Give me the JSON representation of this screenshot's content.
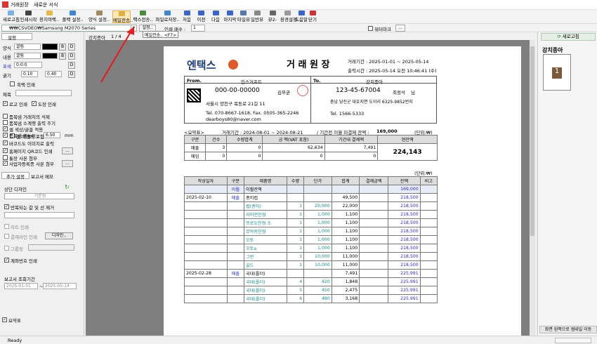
{
  "title": {
    "app": "거래원장",
    "subtitle": "새로운 서식"
  },
  "toolbar": [
    "새로고침",
    "인쇄시작",
    "용지여백..",
    "폴백 설정..",
    "양식 설정..",
    "메일전송..",
    "팩스전송..",
    "파일로저장..",
    "처음",
    "이전",
    "다음",
    "마지막",
    "타일뷰",
    "일반뷰",
    "뷰2-",
    "환경설정..",
    "도움말",
    "닫기"
  ],
  "toolbar2": {
    "path": "₩₩CSVDEO₩Samsung M2070 Series",
    "settings": "설정..",
    "copies_label": "인쇄 매수 :",
    "copies": "1",
    "watermark": "워터마크",
    "dots": "...",
    "tooltip": "메일전송.. <F7>"
  },
  "left": {
    "tab": "설정",
    "font1_label": "양식",
    "font1": "굴림",
    "font2_label": "내용",
    "font2": "굴림",
    "table_label": "표색",
    "table_val": "0:0:0",
    "thick_label": "굵기",
    "thick1": "0.10",
    "thick2": "0.40",
    "bold": "B",
    "dup": "D",
    "dots": "…",
    "title_border": "흑백 인쇄",
    "title_label": "제목",
    "opts": [
      "로고 인쇄",
      "도장 인쇄",
      "품목냄 거래처의 석제",
      "품목냄 소계행 출력 주기",
      "셀 색상/글꼴 적용",
      "셀 배경색 포함",
      "품목냄 행높이 :",
      "바코드도 이미지로 출력",
      "홈페이지 QR코드 인쇄",
      "통장 사본 첨부",
      "사업자등록증 사본 첨부"
    ],
    "row_height": "6.50",
    "mm": "mm",
    "tab2a": "추가 설정",
    "tab2b": "보고서 메모",
    "design_label": "상단 디자인",
    "design_val": "기본형",
    "repeat_label": "반복되는 값 및 선 제거",
    "hist": "차트 인쇄",
    "bottom": "결재라인 인쇄",
    "design_btn": "디자인..",
    "group": "그룹핑",
    "serial": "계좌번호 인쇄",
    "period_label": "보고서 조회기간",
    "from": "2025-01-01",
    "to": "2025-05-14",
    "tilde": "~",
    "summary": "요약표"
  },
  "preview": {
    "client": "강치종아",
    "page": "1 / 4"
  },
  "doc": {
    "logo": "엔택스",
    "title": "거 래 원 장",
    "period": "거래기간 : 2025-01-01 ~ 2025-05-14",
    "printed": "출력시간 : 2025-05-14 오전 10:46:41 (수)",
    "from_label": "From.",
    "from_name": "인스거프트",
    "from_reg": "000-00-00000",
    "from_ceo": "김무균",
    "from_addr": "서울시 양천구 목동로 21길 11",
    "from_tel": "Tel. 070-8667-1618, Fax. 0505-365-2246",
    "from_mail": "dearboys80@naver.com",
    "to_label": "To.",
    "to_name": "강치종아",
    "to_reg": "123-45-67004",
    "to_ceo": "최정석",
    "to_sama": "님",
    "to_addr": "충남 당진군 대호지면 도이리 6325-9852번지",
    "to_tel": "Tel. 1566-5333",
    "sum_label": "<요약표>",
    "sum_period": "거래기간 : 2024-08-01 ~ 2024-08-21",
    "sum_prev": "/ 기간전 이월 미결제 잔액 :",
    "sum_prev_val": "169,000",
    "unit": "(단위:₩)",
    "sum_cols": [
      "구분",
      "건수",
      "수량합계",
      "금 액(VAT 포함)",
      "기간내 결제액",
      "현잔액"
    ],
    "sum_rows": [
      [
        "매출",
        "3",
        "0",
        "62,634",
        "7,491"
      ],
      [
        "매입",
        "0",
        "0",
        "0",
        "0"
      ]
    ],
    "sum_balance": "224,143",
    "main_cols": [
      "작성일자",
      "구분",
      "제품명",
      "수량",
      "단가",
      "합계",
      "결제금액",
      "잔액",
      "비고"
    ],
    "rows": [
      [
        "",
        "이월",
        "이월잔액",
        "",
        "",
        "",
        "",
        "169,000",
        ""
      ],
      [
        "2025-02-10",
        "매출",
        "종이컵",
        "",
        "",
        "49,500",
        "",
        "218,500",
        ""
      ],
      [
        "",
        "",
        "컵(종이)",
        "1",
        "20,000",
        "22,000",
        "",
        "218,500",
        ""
      ],
      [
        "",
        "",
        "라이언인형",
        "1",
        "1,000",
        "1,100",
        "",
        "218,500",
        ""
      ],
      [
        "",
        "",
        "프로도인형 소",
        "1",
        "1,000",
        "1,100",
        "",
        "218,500",
        ""
      ],
      [
        "",
        "",
        "뮤아동인형",
        "1",
        "1,000",
        "1,100",
        "",
        "218,500",
        ""
      ],
      [
        "",
        "",
        "오토",
        "1",
        "1,000",
        "1,100",
        "",
        "218,500",
        ""
      ],
      [
        "",
        "",
        "오토a",
        "1",
        "1,000",
        "1,100",
        "",
        "218,500",
        ""
      ],
      [
        "",
        "",
        "그런",
        "1",
        "10,000",
        "11,000",
        "",
        "218,500",
        ""
      ],
      [
        "",
        "",
        "골드",
        "1",
        "10,000",
        "11,000",
        "",
        "218,500",
        ""
      ],
      [
        "2025-02-28",
        "매출",
        "국대(폴더)",
        "",
        "",
        "7,491",
        "",
        "225,991",
        ""
      ],
      [
        "",
        "",
        "국대(폴더)",
        "4",
        "420",
        "1,848",
        "",
        "225,991",
        ""
      ],
      [
        "",
        "",
        "국대(폴더)",
        "5",
        "450",
        "2,475",
        "",
        "225,991",
        ""
      ],
      [
        "",
        "",
        "국대(폴더)",
        "6",
        "480",
        "3,168",
        "",
        "225,991",
        ""
      ]
    ]
  },
  "right": {
    "refresh": "새로고침",
    "thumb_title": "강치종아",
    "dock": "화면 왼쪽으로 썸네일 이동"
  },
  "status": {
    "text": "Ready"
  }
}
